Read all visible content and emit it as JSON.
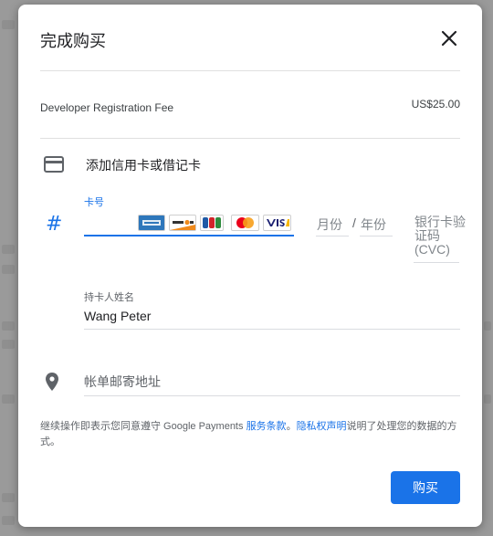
{
  "dialog": {
    "title": "完成购买",
    "close_icon": "close-icon"
  },
  "order": {
    "item_name": "Developer Registration Fee",
    "price": "US$25.00"
  },
  "payment": {
    "add_card_label": "添加信用卡或借记卡",
    "card_icon": "credit-card-icon",
    "card_number_icon": "hash-icon",
    "card_number_label": "卡号",
    "card_number_value": "",
    "card_brands": [
      "amex",
      "discover",
      "jcb",
      "mastercard",
      "visa"
    ],
    "month_placeholder": "月份",
    "date_separator": "/",
    "year_placeholder": "年份",
    "cvc_placeholder": "银行卡验证码 (CVC)",
    "cardholder_label": "持卡人姓名",
    "cardholder_value": "Wang Peter",
    "address_icon": "location-pin-icon",
    "address_placeholder": "帐单邮寄地址"
  },
  "legal": {
    "prefix": "继续操作即表示您同意遵守 Google Payments ",
    "terms_link": "服务条款",
    "separator": "。",
    "privacy_link": "隐私权声明",
    "suffix": "说明了处理您的数据的方式。"
  },
  "actions": {
    "buy_label": "购买"
  },
  "colors": {
    "accent": "#1a73e8",
    "text": "#202124",
    "muted": "#5f6368",
    "divider": "#e0e0e0",
    "overlay": "#9e9e9e"
  }
}
